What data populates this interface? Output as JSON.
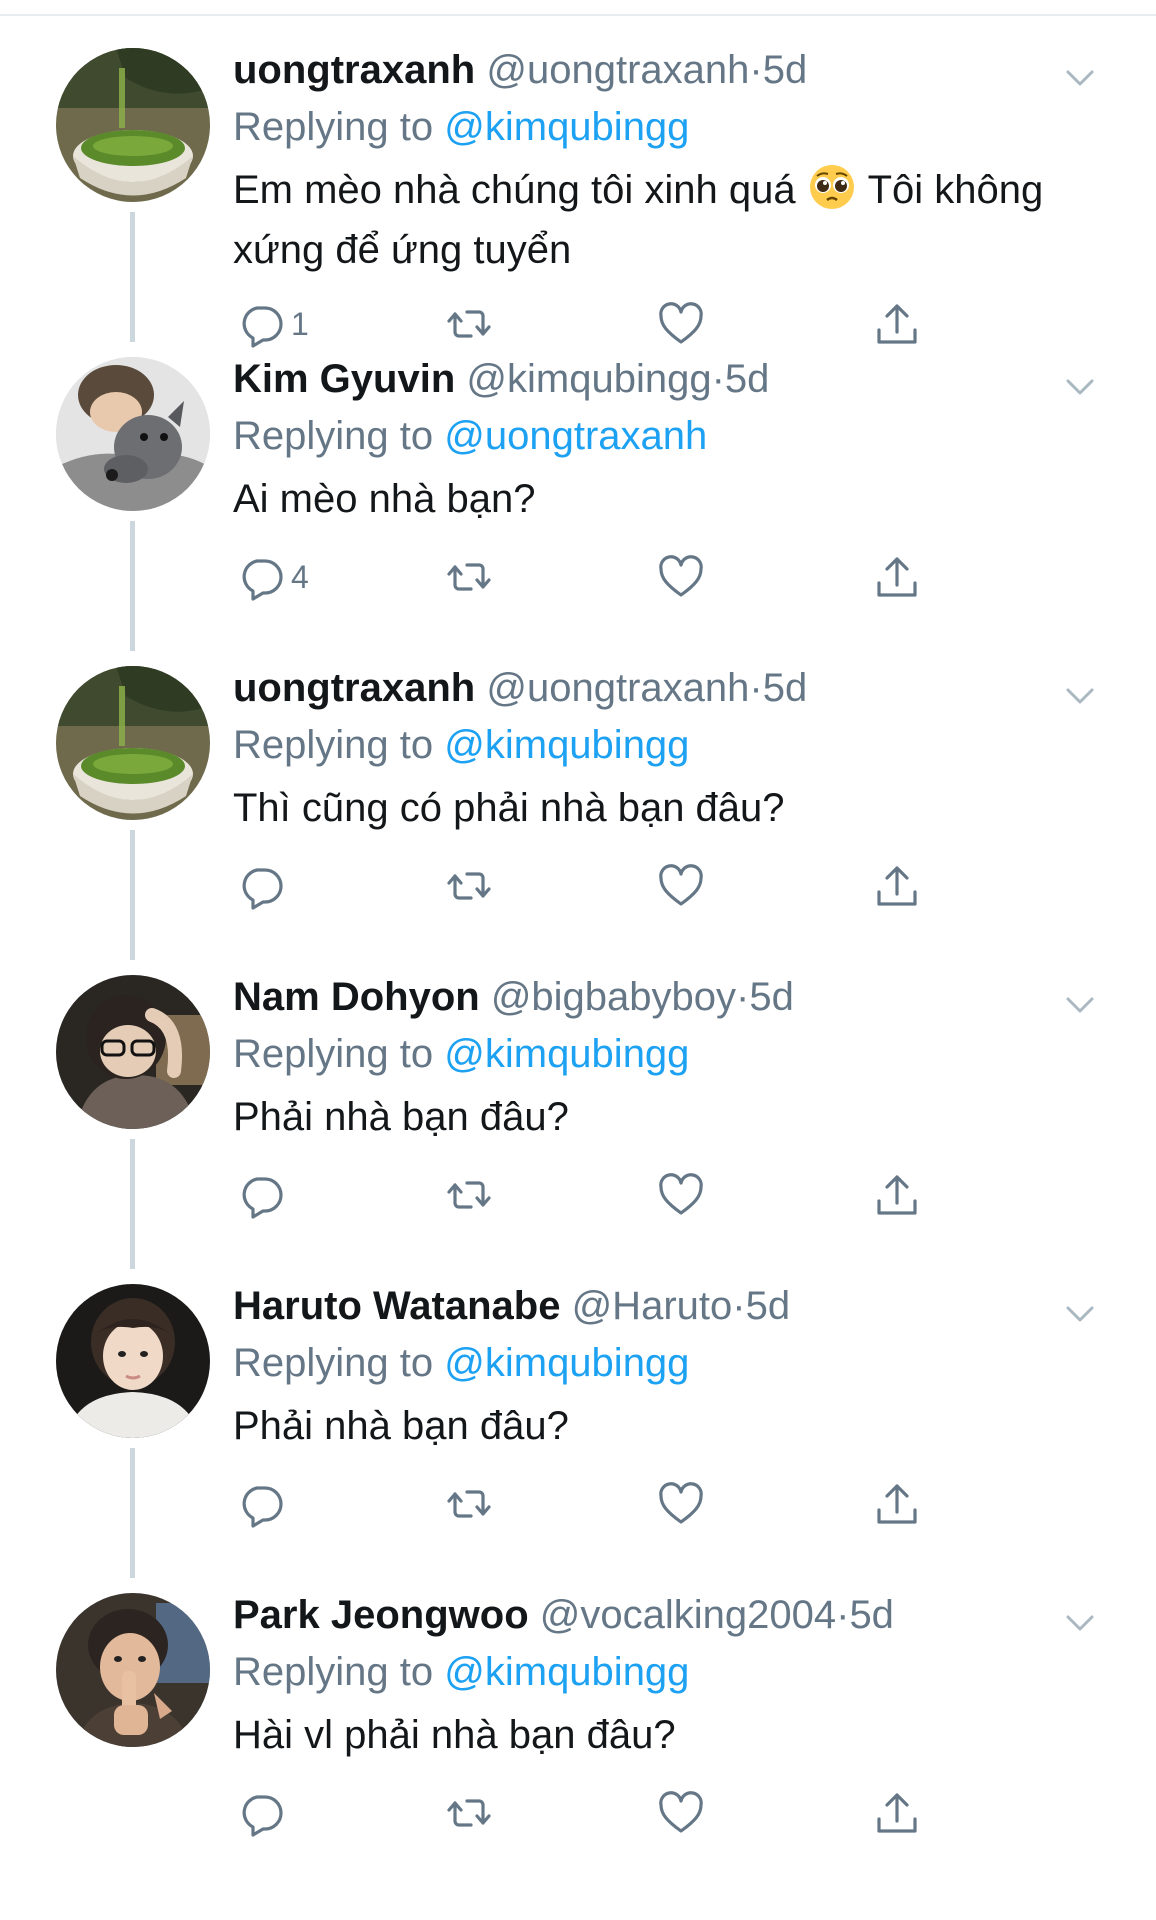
{
  "tweets": [
    {
      "name": "uongtraxanh",
      "handle": "@uongtraxanh",
      "dot": "·",
      "time": "5d",
      "replying_prefix": "Replying to",
      "reply_to": "@kimqubingg",
      "text_before_emoji": "Em mèo nhà chúng tôi xinh quá",
      "emoji": "pleading-face-emoji",
      "text_after_emoji": "Tôi không xứng để ứng tuyển",
      "reply_count": "1",
      "avatar": "green-tea-avatar"
    },
    {
      "name": "Kim Gyuvin",
      "handle": "@kimqubingg",
      "dot": "·",
      "time": "5d",
      "replying_prefix": "Replying to",
      "reply_to": "@uongtraxanh",
      "text": "Ai mèo nhà bạn?",
      "reply_count": "4",
      "avatar": "boy-with-dog-avatar"
    },
    {
      "name": "uongtraxanh",
      "handle": "@uongtraxanh",
      "dot": "·",
      "time": "5d",
      "replying_prefix": "Replying to",
      "reply_to": "@kimqubingg",
      "text": "Thì cũng có phải nhà bạn đâu?",
      "reply_count": "",
      "avatar": "green-tea-avatar"
    },
    {
      "name": "Nam Dohyon",
      "handle": "@bigbabyboy",
      "dot": "·",
      "time": "5d",
      "replying_prefix": "Replying to",
      "reply_to": "@kimqubingg",
      "text": "Phải nhà bạn đâu?",
      "reply_count": "",
      "avatar": "boy-with-glasses-avatar"
    },
    {
      "name": "Haruto Watanabe",
      "handle": "@Haruto",
      "dot": "·",
      "time": "5d",
      "replying_prefix": "Replying to",
      "reply_to": "@kimqubingg",
      "text": "Phải nhà bạn đâu?",
      "reply_count": "",
      "avatar": "boy-portrait-avatar"
    },
    {
      "name": "Park Jeongwoo",
      "handle": "@vocalking2004",
      "dot": "·",
      "time": "5d",
      "replying_prefix": "Replying to",
      "reply_to": "@kimqubingg",
      "text": "Hài vl phải nhà bạn đâu?",
      "reply_count": "",
      "avatar": "boy-shush-avatar"
    }
  ],
  "colors": {
    "link": "#1da1f2",
    "secondary_text": "#657786",
    "primary_text": "#14171a",
    "thread_line": "#ccd6dd",
    "icon": "#657786"
  },
  "icons": {
    "reply": "reply-icon",
    "retweet": "retweet-icon",
    "like": "heart-icon",
    "share": "share-icon",
    "more": "chevron-down-icon"
  }
}
